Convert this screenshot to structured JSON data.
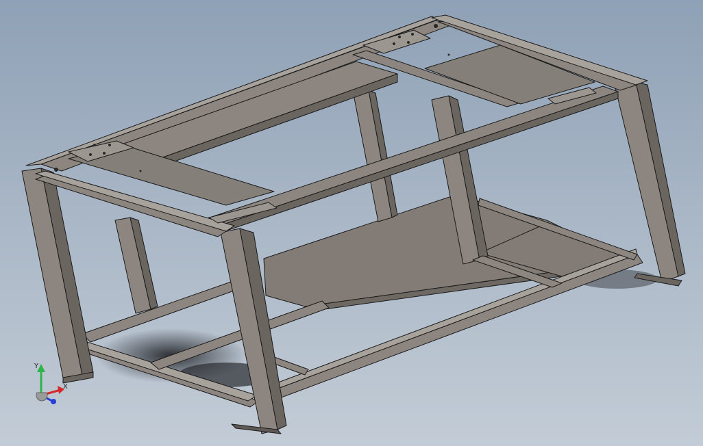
{
  "viewport": {
    "model_description_hidden": "",
    "background_top": "#8fa1b6",
    "background_bottom": "#c3ccd6",
    "steel_color": "#8d8680",
    "steel_dark": "#6b6560",
    "steel_light": "#a8a29c",
    "edge_color": "#1a1a1a"
  },
  "triad": {
    "x_label": "X",
    "y_label": "Y",
    "x_color": "#d42a2a",
    "y_color": "#2fb34a",
    "z_color": "#2a3fd4",
    "icon": "coordinate-triad-icon"
  }
}
